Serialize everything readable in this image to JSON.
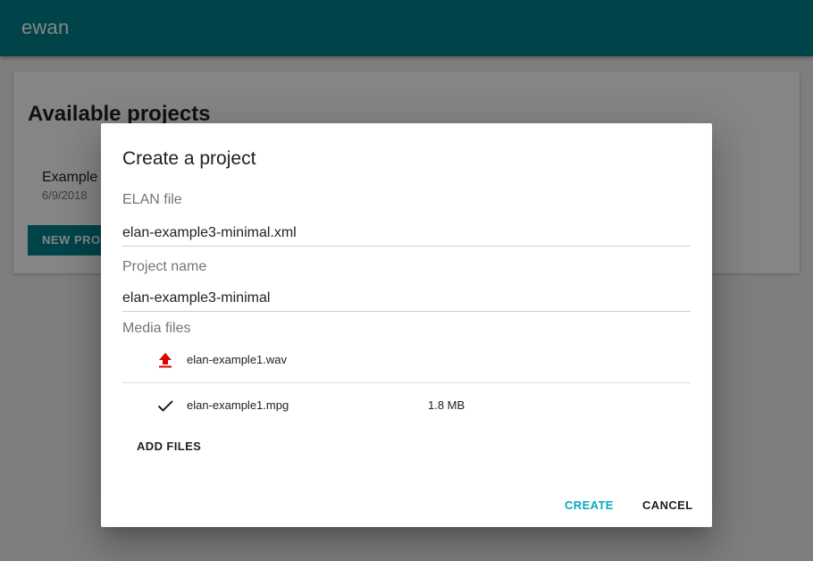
{
  "app": {
    "title": "ewan"
  },
  "page": {
    "heading": "Available projects",
    "projects": [
      {
        "name": "Example",
        "date": "6/9/2018"
      }
    ],
    "new_project_label": "NEW PROJECT"
  },
  "dialog": {
    "title": "Create a project",
    "elan_file": {
      "label": "ELAN file",
      "value": "elan-example3-minimal.xml"
    },
    "project_name": {
      "label": "Project name",
      "value": "elan-example3-minimal"
    },
    "media_files": {
      "label": "Media files",
      "files": [
        {
          "name": "elan-example1.wav",
          "size": "",
          "status": "upload-icon"
        },
        {
          "name": "elan-example1.mpg",
          "size": "1.8 MB",
          "status": "check-icon"
        }
      ]
    },
    "add_files_label": "ADD FILES",
    "create_label": "CREATE",
    "cancel_label": "CANCEL"
  },
  "colors": {
    "primary": "#00838f",
    "accent": "#00acc1",
    "upload_icon": "#e00000"
  }
}
